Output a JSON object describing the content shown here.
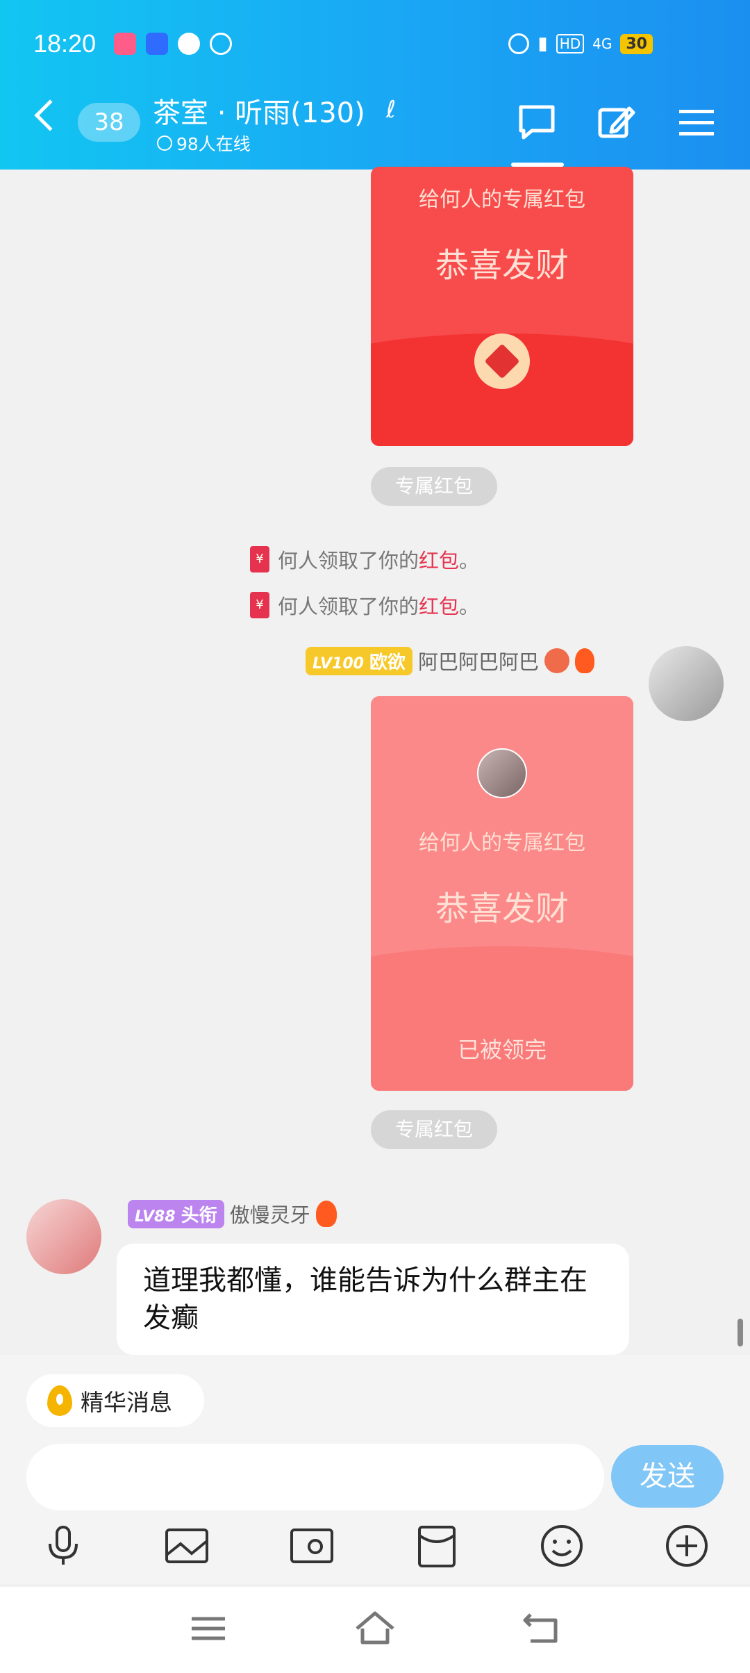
{
  "status": {
    "time": "18:20",
    "battery": "30",
    "network": "4G"
  },
  "header": {
    "unread": "38",
    "title": "茶室 · 听雨(130)",
    "online": "98人在线"
  },
  "packets": [
    {
      "sub": "给何人的专属红包",
      "main": "恭喜发财",
      "tag": "专属红包"
    },
    {
      "sub": "给何人的专属红包",
      "main": "恭喜发财",
      "status": "已被领完",
      "tag": "专属红包"
    }
  ],
  "system_msgs": [
    {
      "env": "¥",
      "prefix": "何人领取了你的",
      "link": "红包",
      "suffix": "。"
    },
    {
      "env": "¥",
      "prefix": "何人领取了你的",
      "link": "红包",
      "suffix": "。"
    }
  ],
  "sender1": {
    "level": "LV100",
    "title": "欧欲",
    "name": "阿巴阿巴阿巴"
  },
  "sender2": {
    "level": "LV88",
    "title": "头衔",
    "name": "傲慢灵牙",
    "message": "道理我都懂，谁能告诉为什么群主在发癫"
  },
  "composer": {
    "featured": "精华消息",
    "placeholder": "",
    "send": "发送"
  },
  "colors": {
    "header_start": "#12c6f2",
    "header_end": "#1b8ff0",
    "red": "#e5334f",
    "send": "#80c6f6"
  }
}
